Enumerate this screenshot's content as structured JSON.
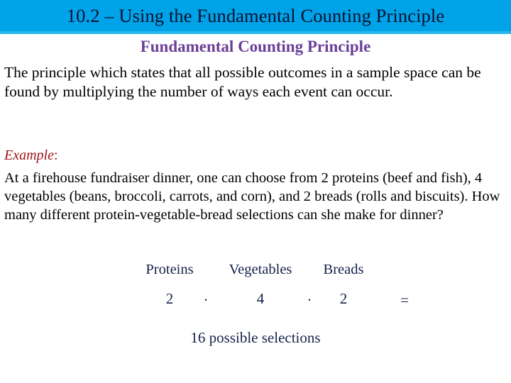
{
  "slide": {
    "title": "10.2 – Using the Fundamental Counting Principle",
    "subtitle": "Fundamental Counting Principle",
    "definition": "The principle which states that all possible outcomes in a sample space can be found by multiplying the number of ways each event can occur.",
    "example": {
      "label": "Example",
      "label_colon": ":",
      "body": "At a firehouse fundraiser dinner,  one can choose from 2 proteins (beef and fish), 4 vegetables (beans, broccoli, carrots, and corn), and 2 breads (rolls and biscuits). How many different protein-vegetable-bread selections can she make for dinner?"
    },
    "computation": {
      "headers": [
        "Proteins",
        "Vegetables",
        "Breads"
      ],
      "values": [
        "2",
        "4",
        "2"
      ],
      "operator_multiply_1": "·",
      "operator_multiply_2": "·",
      "operator_equals": "="
    },
    "result": "16 possible selections"
  },
  "colors": {
    "banner_background": "#00A3E8",
    "banner_underline": "#2DB6EC",
    "title_text": "#0B1030",
    "subtitle_text": "#6B3E98",
    "body_text": "#000000",
    "example_label_text": "#A01515",
    "computation_text": "#16224A",
    "page_background": "#FFFFFF"
  }
}
